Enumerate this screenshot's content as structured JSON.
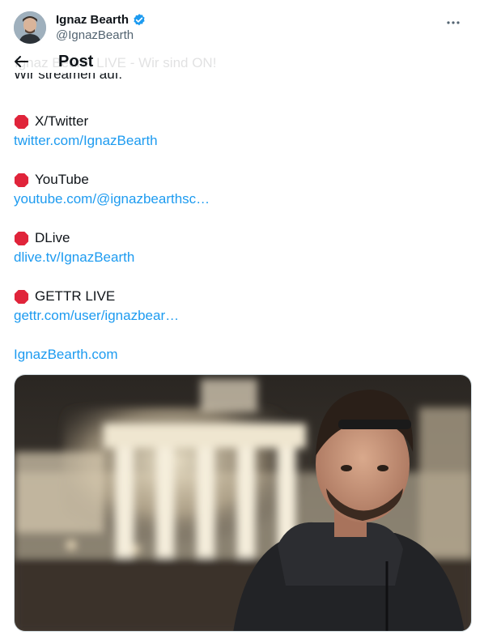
{
  "author": {
    "display_name": "Ignaz Bearth",
    "handle": "@IgnazBearth",
    "verified": true
  },
  "nav": {
    "title": "Post"
  },
  "post": {
    "faded_first_line": "Ignaz Bearth LIVE - Wir sind ON!",
    "intro": "Wir streamen auf:",
    "platforms": [
      {
        "emoji": "stop-sign-icon",
        "name": "X/Twitter",
        "link": "twitter.com/IgnazBearth"
      },
      {
        "emoji": "stop-sign-icon",
        "name": "YouTube",
        "link": "youtube.com/@ignazbearthsc…"
      },
      {
        "emoji": "stop-sign-icon",
        "name": "DLive",
        "link": "dlive.tv/IgnazBearth"
      },
      {
        "emoji": "stop-sign-icon",
        "name": "GETTR LIVE",
        "link": "gettr.com/user/ignazbear…"
      }
    ],
    "website": "IgnazBearth.com"
  },
  "colors": {
    "link": "#1d9bf0",
    "verified": "#1d9bf0",
    "stop": "#e0243a"
  }
}
